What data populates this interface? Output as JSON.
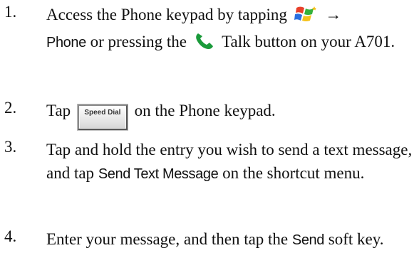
{
  "steps": [
    {
      "number": "1.",
      "pre": "Access the Phone keypad by tapping",
      "start_icon": "windows-start-icon",
      "arrow": "→",
      "phone_ui": "Phone",
      "mid": "or pressing the",
      "talk_icon": "phone-talk-icon",
      "post": "Talk button on your A701."
    },
    {
      "number": "2.",
      "pre": "Tap",
      "button_label": "Speed Dial",
      "post": "on the Phone keypad."
    },
    {
      "number": "3.",
      "pre": "Tap and hold the entry you wish to send a text message, and tap",
      "menu_item": "Send Text Message",
      "post": "on the shortcut menu."
    },
    {
      "number": "4.",
      "pre": "Enter your message, and then tap the",
      "soft_key": "Send",
      "post": "soft key."
    }
  ],
  "colors": {
    "text": "#111111",
    "talk_icon": "#1a9a3a"
  }
}
